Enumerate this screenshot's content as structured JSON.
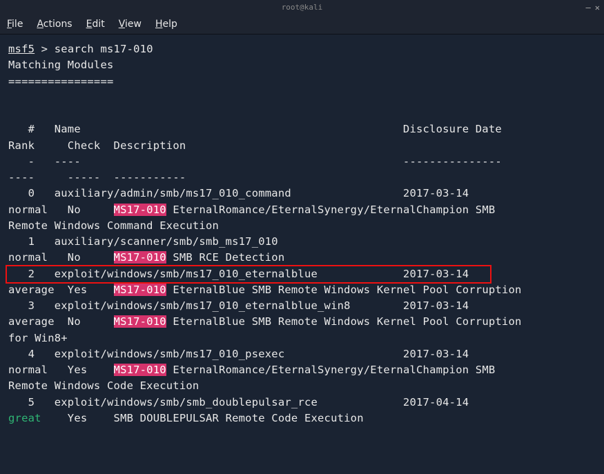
{
  "titlebar": {
    "title": "root@kali"
  },
  "menu": {
    "file": "File",
    "actions": "Actions",
    "edit": "Edit",
    "view": "View",
    "help": "Help"
  },
  "prompt": {
    "msf": "msf5",
    "gt": " > ",
    "cmd": "search ms17-010"
  },
  "section_title": "Matching Modules",
  "section_underline": "================",
  "header": {
    "num": "   #",
    "name": "  Name",
    "disclosure": "Disclosure Date",
    "rank": "Rank",
    "check": "Check",
    "desc": "Description",
    "dash_num": "   -",
    "dash_name": "  ----",
    "dash_disc": "---------------",
    "dash_rank": "----",
    "dash_check": "-----",
    "dash_desc": "-----------"
  },
  "rows": [
    {
      "num": "   0",
      "name": "  auxiliary/admin/smb/ms17_010_command",
      "date": "2017-03-14",
      "rank": "normal",
      "check": "No",
      "kw": "MS17-010",
      "desc_pre": " EternalRomance/EternalSynergy/EternalChampion SMB Remote Windows Command Execution"
    },
    {
      "num": "   1",
      "name": "  auxiliary/scanner/smb/smb_ms17_010",
      "date": "",
      "rank": "normal",
      "check": "No",
      "kw": "MS17-010",
      "desc_pre": " SMB RCE Detection"
    },
    {
      "num": "   2",
      "name": "  exploit/windows/smb/ms17_010_eternalblue",
      "date": "2017-03-14",
      "rank": "average",
      "check": "Yes",
      "kw": "MS17-010",
      "desc_pre": " EternalBlue SMB Remote Windows Kernel Pool Corruption",
      "boxed": true
    },
    {
      "num": "   3",
      "name": "  exploit/windows/smb/ms17_010_eternalblue_win8",
      "date": "2017-03-14",
      "rank": "average",
      "check": "No",
      "kw": "MS17-010",
      "desc_pre": " EternalBlue SMB Remote Windows Kernel Pool Corruption for Win8+"
    },
    {
      "num": "   4",
      "name": "  exploit/windows/smb/ms17_010_psexec",
      "date": "2017-03-14",
      "rank": "normal",
      "check": "Yes",
      "kw": "MS17-010",
      "desc_pre": " EternalRomance/EternalSynergy/EternalChampion SMB Remote Windows Code Execution"
    },
    {
      "num": "   5",
      "name": "  exploit/windows/smb/smb_doublepulsar_rce",
      "date": "2017-04-14",
      "rank": "great",
      "check": "Yes",
      "kw": "",
      "desc_pre": "SMB DOUBLEPULSAR Remote Code Execution"
    }
  ]
}
